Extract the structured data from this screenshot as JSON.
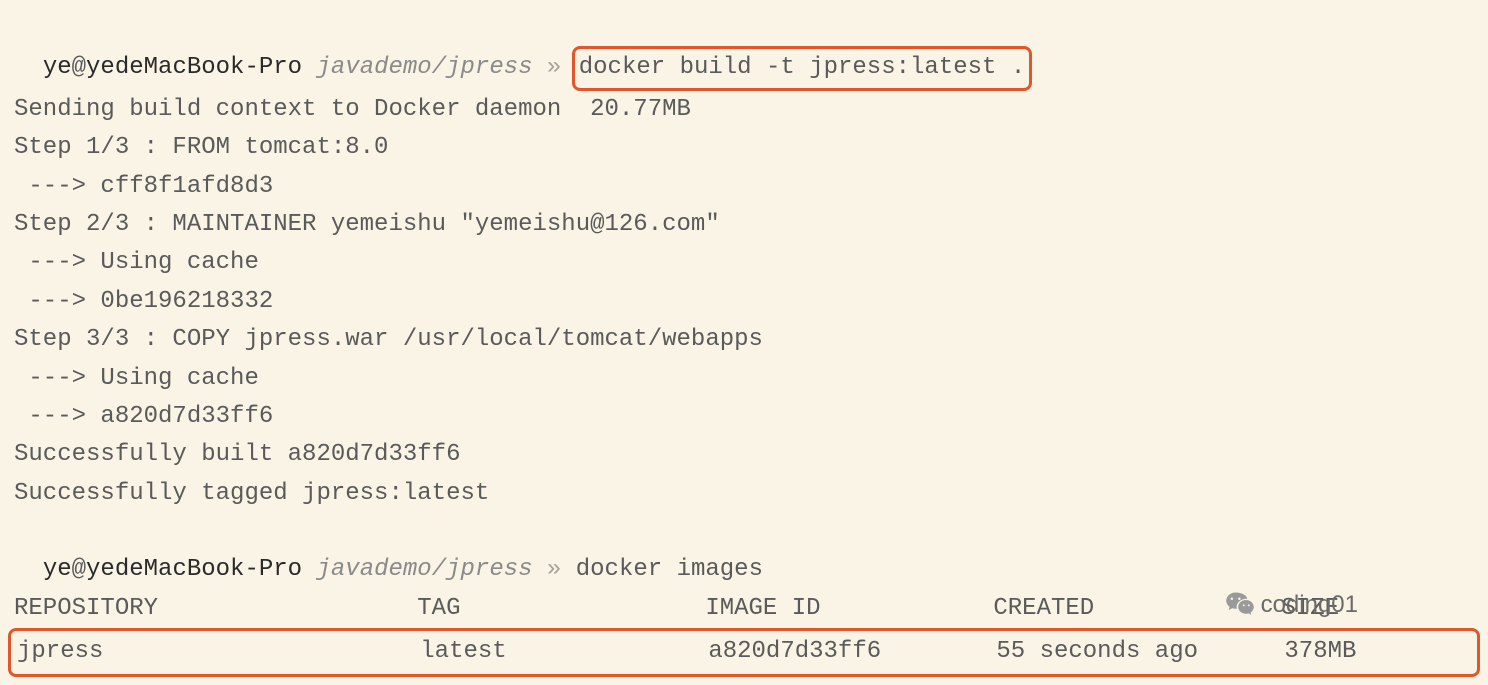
{
  "prompt1": {
    "user": "ye",
    "at": "@",
    "host": "yedeMacBook-Pro",
    "path": "javademo/jpress",
    "sep": " » ",
    "command": "docker build -t jpress:latest ."
  },
  "output_lines": [
    "Sending build context to Docker daemon  20.77MB",
    "Step 1/3 : FROM tomcat:8.0",
    " ---> cff8f1afd8d3",
    "Step 2/3 : MAINTAINER yemeishu \"yemeishu@126.com\"",
    " ---> Using cache",
    " ---> 0be196218332",
    "Step 3/3 : COPY jpress.war /usr/local/tomcat/webapps",
    " ---> Using cache",
    " ---> a820d7d33ff6",
    "Successfully built a820d7d33ff6",
    "Successfully tagged jpress:latest"
  ],
  "prompt2": {
    "user": "ye",
    "at": "@",
    "host": "yedeMacBook-Pro",
    "path": "javademo/jpress",
    "sep": " » ",
    "command": "docker images"
  },
  "table_header": "REPOSITORY                  TAG                 IMAGE ID            CREATED             SIZE",
  "table_row": "jpress                      latest              a820d7d33ff6        55 seconds ago      378MB",
  "watermark": "coding01"
}
